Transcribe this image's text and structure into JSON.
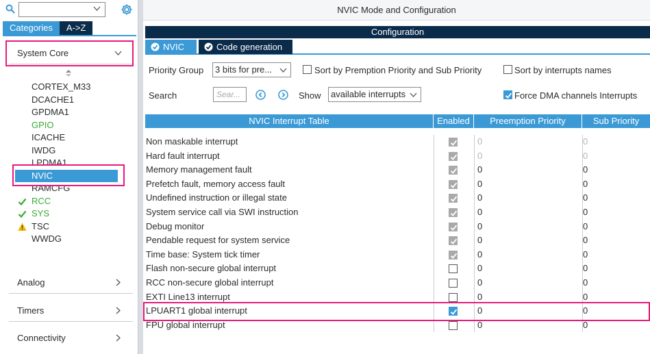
{
  "sidebar": {
    "search": {
      "value": "",
      "placeholder": ""
    },
    "tabs": [
      "Categories",
      "A->Z"
    ],
    "sections": {
      "system_core": "System Core",
      "analog": "Analog",
      "timers": "Timers",
      "connectivity": "Connectivity"
    },
    "items": [
      {
        "label": "CORTEX_M33",
        "status": "none"
      },
      {
        "label": "DCACHE1",
        "status": "none"
      },
      {
        "label": "GPDMA1",
        "status": "none"
      },
      {
        "label": "GPIO",
        "status": "green"
      },
      {
        "label": "ICACHE",
        "status": "none"
      },
      {
        "label": "IWDG",
        "status": "none"
      },
      {
        "label": "LPDMA1",
        "status": "none"
      },
      {
        "label": "NVIC",
        "status": "selected"
      },
      {
        "label": "RAMCFG",
        "status": "none"
      },
      {
        "label": "RCC",
        "status": "check"
      },
      {
        "label": "SYS",
        "status": "check"
      },
      {
        "label": "TSC",
        "status": "warning"
      },
      {
        "label": "WWDG",
        "status": "none"
      }
    ]
  },
  "main": {
    "title": "NVIC Mode and Configuration",
    "config_header": "Configuration",
    "tabs": [
      "NVIC",
      "Code generation"
    ],
    "priority_group": {
      "label": "Priority Group",
      "value": "3 bits for pre..."
    },
    "sort_premption": "Sort by Premption Priority and Sub Priority",
    "sort_names": "Sort by interrupts names",
    "search": {
      "label": "Search",
      "placeholder": "Sear..."
    },
    "show": {
      "label": "Show",
      "value": "available interrupts"
    },
    "force_dma": "Force DMA channels Interrupts"
  },
  "table": {
    "headers": [
      "NVIC Interrupt Table",
      "Enabled",
      "Preemption Priority",
      "Sub Priority"
    ],
    "rows": [
      {
        "name": "Non maskable interrupt",
        "enabled": true,
        "locked": true,
        "pre": "0",
        "sub": "0",
        "dim": true
      },
      {
        "name": "Hard fault interrupt",
        "enabled": true,
        "locked": true,
        "pre": "0",
        "sub": "0",
        "dim": true
      },
      {
        "name": "Memory management fault",
        "enabled": true,
        "locked": true,
        "pre": "0",
        "sub": "0",
        "dim": false
      },
      {
        "name": "Prefetch fault, memory access fault",
        "enabled": true,
        "locked": true,
        "pre": "0",
        "sub": "0",
        "dim": false
      },
      {
        "name": "Undefined instruction or illegal state",
        "enabled": true,
        "locked": true,
        "pre": "0",
        "sub": "0",
        "dim": false
      },
      {
        "name": "System service call via SWI instruction",
        "enabled": true,
        "locked": true,
        "pre": "0",
        "sub": "0",
        "dim": false
      },
      {
        "name": "Debug monitor",
        "enabled": true,
        "locked": true,
        "pre": "0",
        "sub": "0",
        "dim": false
      },
      {
        "name": "Pendable request for system service",
        "enabled": true,
        "locked": true,
        "pre": "0",
        "sub": "0",
        "dim": false
      },
      {
        "name": "Time base: System tick timer",
        "enabled": true,
        "locked": true,
        "pre": "0",
        "sub": "0",
        "dim": false
      },
      {
        "name": "Flash non-secure global interrupt",
        "enabled": false,
        "locked": false,
        "pre": "0",
        "sub": "0",
        "dim": false
      },
      {
        "name": "RCC non-secure global interrupt",
        "enabled": false,
        "locked": false,
        "pre": "0",
        "sub": "0",
        "dim": false
      },
      {
        "name": "EXTI Line13 interrupt",
        "enabled": false,
        "locked": false,
        "pre": "0",
        "sub": "0",
        "dim": false
      },
      {
        "name": "LPUART1 global interrupt",
        "enabled": true,
        "locked": false,
        "pre": "0",
        "sub": "0",
        "dim": false
      },
      {
        "name": "FPU global interrupt",
        "enabled": false,
        "locked": false,
        "pre": "0",
        "sub": "0",
        "dim": false
      }
    ]
  },
  "colors": {
    "accent": "#3b9ad6",
    "dark_header": "#0b2b4a",
    "highlight": "#e8187b",
    "ok_green": "#3aa835",
    "warning": "#f2b705"
  }
}
